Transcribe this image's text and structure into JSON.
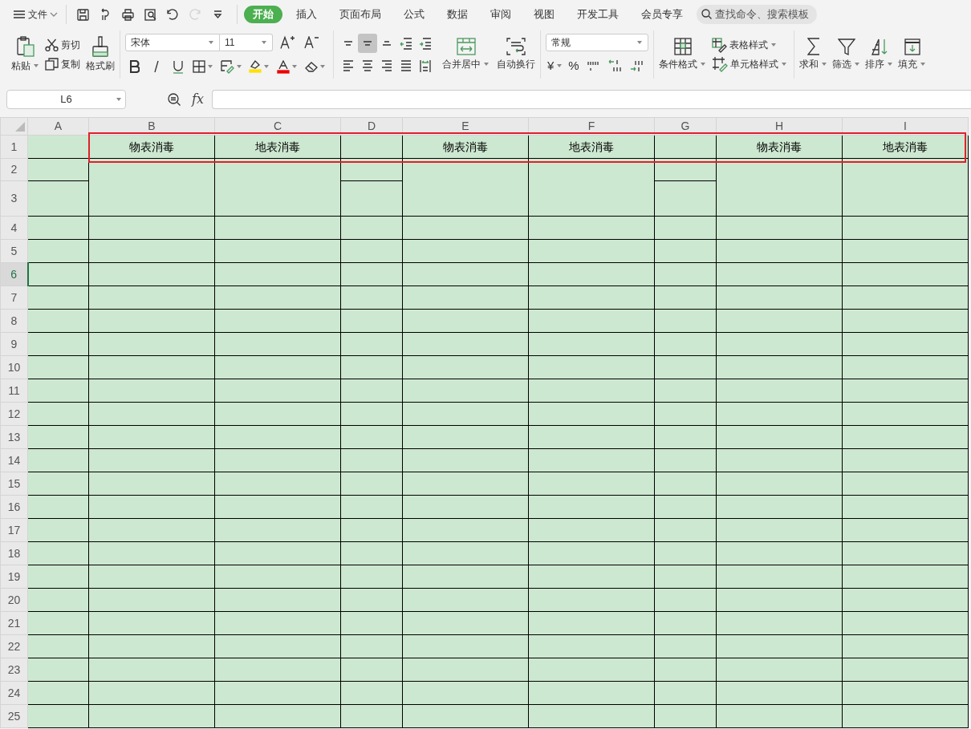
{
  "menu": {
    "label": "文件"
  },
  "quick_access": [
    {
      "disabled": false
    },
    {
      "disabled": false
    },
    {
      "disabled": false
    },
    {
      "disabled": false
    },
    {
      "disabled": false
    },
    {
      "disabled": true
    },
    {
      "disabled": false
    }
  ],
  "tabs": [
    {
      "label": "开始",
      "selected": true
    },
    {
      "label": "插入",
      "selected": false
    },
    {
      "label": "页面布局",
      "selected": false
    },
    {
      "label": "公式",
      "selected": false
    },
    {
      "label": "数据",
      "selected": false
    },
    {
      "label": "审阅",
      "selected": false
    },
    {
      "label": "视图",
      "selected": false
    },
    {
      "label": "开发工具",
      "selected": false
    },
    {
      "label": "会员专享",
      "selected": false
    }
  ],
  "search": {
    "placeholder": "查找命令、搜索模板"
  },
  "ribbon": {
    "clipboard": {
      "paste": "粘贴",
      "cut": "剪切",
      "copy": "复制",
      "format_painter": "格式刷"
    },
    "font": {
      "name": "宋体",
      "size": "11"
    },
    "align_buttons": [
      {
        "selected": false
      },
      {
        "selected": true
      },
      {
        "selected": false
      },
      {
        "selected": false
      },
      {
        "selected": false
      },
      {
        "selected": false
      },
      {
        "selected": false
      },
      {
        "selected": false
      },
      {
        "selected": false
      },
      {
        "selected": false
      }
    ],
    "alignment": {
      "merge": "合并居中",
      "wrap": "自动换行"
    },
    "number": {
      "format": "常规",
      "currency": "¥",
      "percent": "%"
    },
    "styles": {
      "conditional": "条件格式",
      "table_style": "表格样式",
      "cell_style": "单元格样式"
    },
    "editing": [
      "求和",
      "筛选",
      "排序",
      "填充"
    ]
  },
  "formula_bar": {
    "name_box": "L6",
    "fx": "fx"
  },
  "sheet": {
    "columns": [
      "A",
      "B",
      "C",
      "D",
      "E",
      "F",
      "G",
      "H",
      "I"
    ],
    "rows": [
      {
        "label": "1",
        "active": false
      },
      {
        "label": "2",
        "active": false
      },
      {
        "label": "3",
        "active": false
      },
      {
        "label": "4",
        "active": false
      },
      {
        "label": "5",
        "active": false
      },
      {
        "label": "6",
        "active": true
      },
      {
        "label": "7",
        "active": false
      },
      {
        "label": "8",
        "active": false
      },
      {
        "label": "9",
        "active": false
      },
      {
        "label": "10",
        "active": false
      },
      {
        "label": "11",
        "active": false
      },
      {
        "label": "12",
        "active": false
      },
      {
        "label": "13",
        "active": false
      },
      {
        "label": "14",
        "active": false
      },
      {
        "label": "15",
        "active": false
      },
      {
        "label": "16",
        "active": false
      },
      {
        "label": "17",
        "active": false
      },
      {
        "label": "18",
        "active": false
      },
      {
        "label": "19",
        "active": false
      },
      {
        "label": "20",
        "active": false
      },
      {
        "label": "21",
        "active": false
      },
      {
        "label": "22",
        "active": false
      },
      {
        "label": "23",
        "active": false
      },
      {
        "label": "24",
        "active": false
      },
      {
        "label": "25",
        "active": false
      }
    ],
    "row_1_cells": [
      null,
      "物表消毒",
      "地表消毒",
      null,
      "物表消毒",
      "地表消毒",
      null,
      "物表消毒",
      "地表消毒"
    ]
  }
}
